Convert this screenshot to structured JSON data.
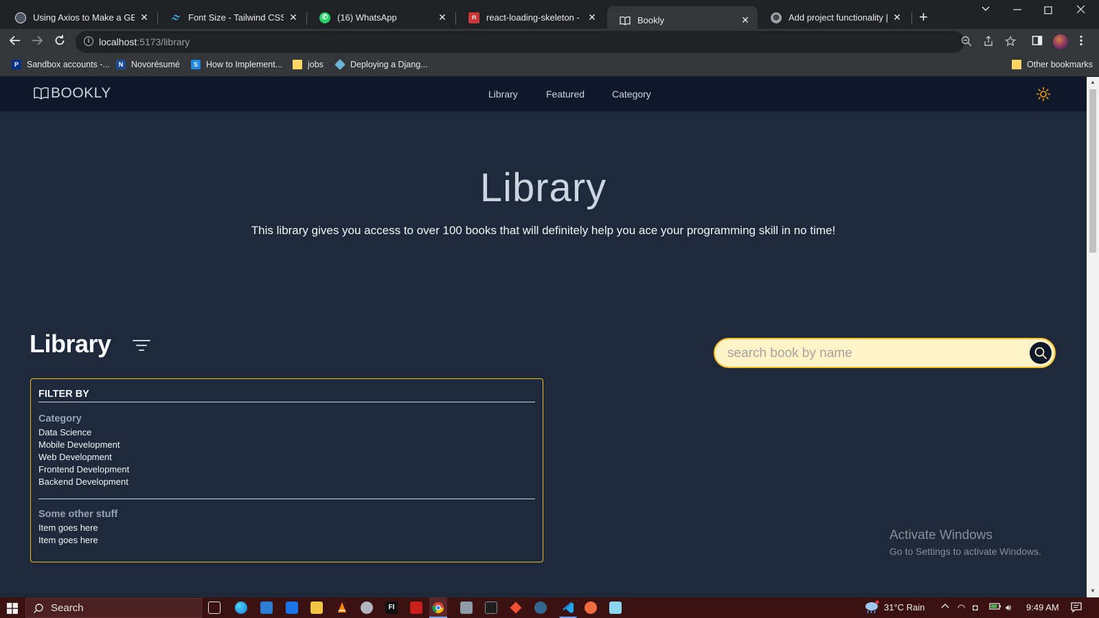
{
  "browser": {
    "tabs": [
      {
        "title": "Using Axios to Make a GET Re",
        "favicon": "openai-icon",
        "active": false
      },
      {
        "title": "Font Size - Tailwind CSS",
        "favicon": "tailwind-icon",
        "active": false
      },
      {
        "title": "(16) WhatsApp",
        "favicon": "whatsapp-icon",
        "active": false
      },
      {
        "title": "react-loading-skeleton - npm",
        "favicon": "npm-icon",
        "active": false
      },
      {
        "title": "Bookly",
        "favicon": "book-icon",
        "active": true
      },
      {
        "title": "Add project functionality | Dj",
        "favicon": "globe-icon",
        "active": false
      }
    ],
    "new_tab": "+",
    "url_host": "localhost",
    "url_path": ":5173/library",
    "bookmarks": [
      {
        "label": "Sandbox accounts -...",
        "icon": "paypal-icon"
      },
      {
        "label": "Novorésumé",
        "icon": "novoresume-icon"
      },
      {
        "label": "How to Implement...",
        "icon": "s-icon"
      },
      {
        "label": "jobs",
        "icon": "folder-icon"
      },
      {
        "label": "Deploying a Djang...",
        "icon": "cube-icon"
      }
    ],
    "other_bookmarks": "Other bookmarks"
  },
  "app": {
    "brand": "BOOKLY",
    "nav": [
      "Library",
      "Featured",
      "Category"
    ],
    "hero_title": "Library",
    "hero_subtitle": "This library gives you access to over 100 books that will definitely help you ace your programming skill in no time!",
    "section_title": "Library",
    "search_placeholder": "search book by name",
    "filter": {
      "heading": "FILTER BY",
      "groups": [
        {
          "title": "Category",
          "items": [
            "Data Science",
            "Mobile Development",
            "Web Development",
            "Frontend Development",
            "Backend Development"
          ]
        },
        {
          "title": "Some other stuff",
          "items": [
            "Item goes here",
            "Item goes here"
          ]
        }
      ]
    }
  },
  "watermark": {
    "line1": "Activate Windows",
    "line2": "Go to Settings to activate Windows."
  },
  "taskbar": {
    "search_label": "Search",
    "weather": "31°C  Rain",
    "time": "9:49 AM"
  },
  "colors": {
    "page_bg": "#1e293b",
    "nav_bg": "#0f172a",
    "accent": "#fbbf24",
    "search_bg": "#fef3c7"
  }
}
